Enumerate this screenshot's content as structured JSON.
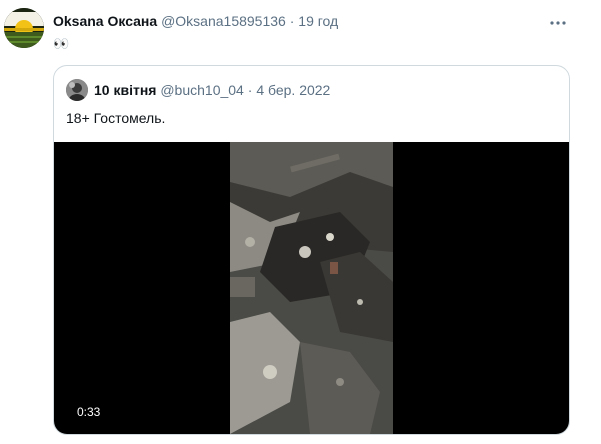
{
  "tweet": {
    "author_name": "Oksana Оксана",
    "author_handle": "@Oksana15895136",
    "separator": "·",
    "time": "19 год",
    "text": "👀",
    "avatar_icon": "sunflower-field-avatar",
    "more_icon": "more-options-icon"
  },
  "quote": {
    "author_name": "10 квітня",
    "author_handle": "@buch10_04",
    "separator": "·",
    "date": "4 бер. 2022",
    "text": "18+ Гостомель.",
    "avatar_icon": "profile-photo-avatar",
    "video": {
      "duration": "0:33"
    }
  },
  "colors": {
    "secondary_text": "#5b7083",
    "border": "#cfd9de",
    "video_background": "#000000"
  }
}
